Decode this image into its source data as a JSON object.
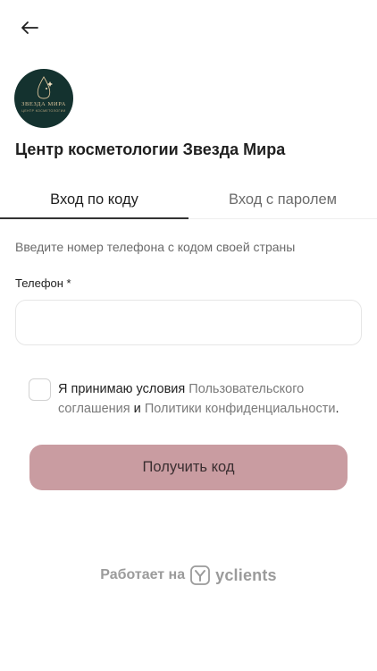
{
  "header": {
    "back_icon": "arrow-left-icon"
  },
  "salon": {
    "logo_name": "ЗВЕЗДА МИРА",
    "logo_subtitle": "ЦЕНТР КОСМЕТОЛОГИИ",
    "title": "Центр косметологии Звезда Мира"
  },
  "tabs": [
    {
      "label": "Вход по коду",
      "active": true
    },
    {
      "label": "Вход с паролем",
      "active": false
    }
  ],
  "form": {
    "hint": "Введите номер телефона с кодом своей страны",
    "phone_label": "Телефон *",
    "phone_value": "",
    "phone_placeholder": ""
  },
  "agreement": {
    "prefix": "Я принимаю условия ",
    "link_terms": "Пользовательского соглашения",
    "middle": " и ",
    "link_privacy": "Политики конфиденциальности",
    "suffix": ".",
    "checked": false
  },
  "submit": {
    "label": "Получить код"
  },
  "footer": {
    "powered_text": "Работает на",
    "brand": "yclients"
  },
  "colors": {
    "accent_button": "#c99ca1",
    "logo_bg": "#14322f",
    "link": "#7a7a7a"
  }
}
